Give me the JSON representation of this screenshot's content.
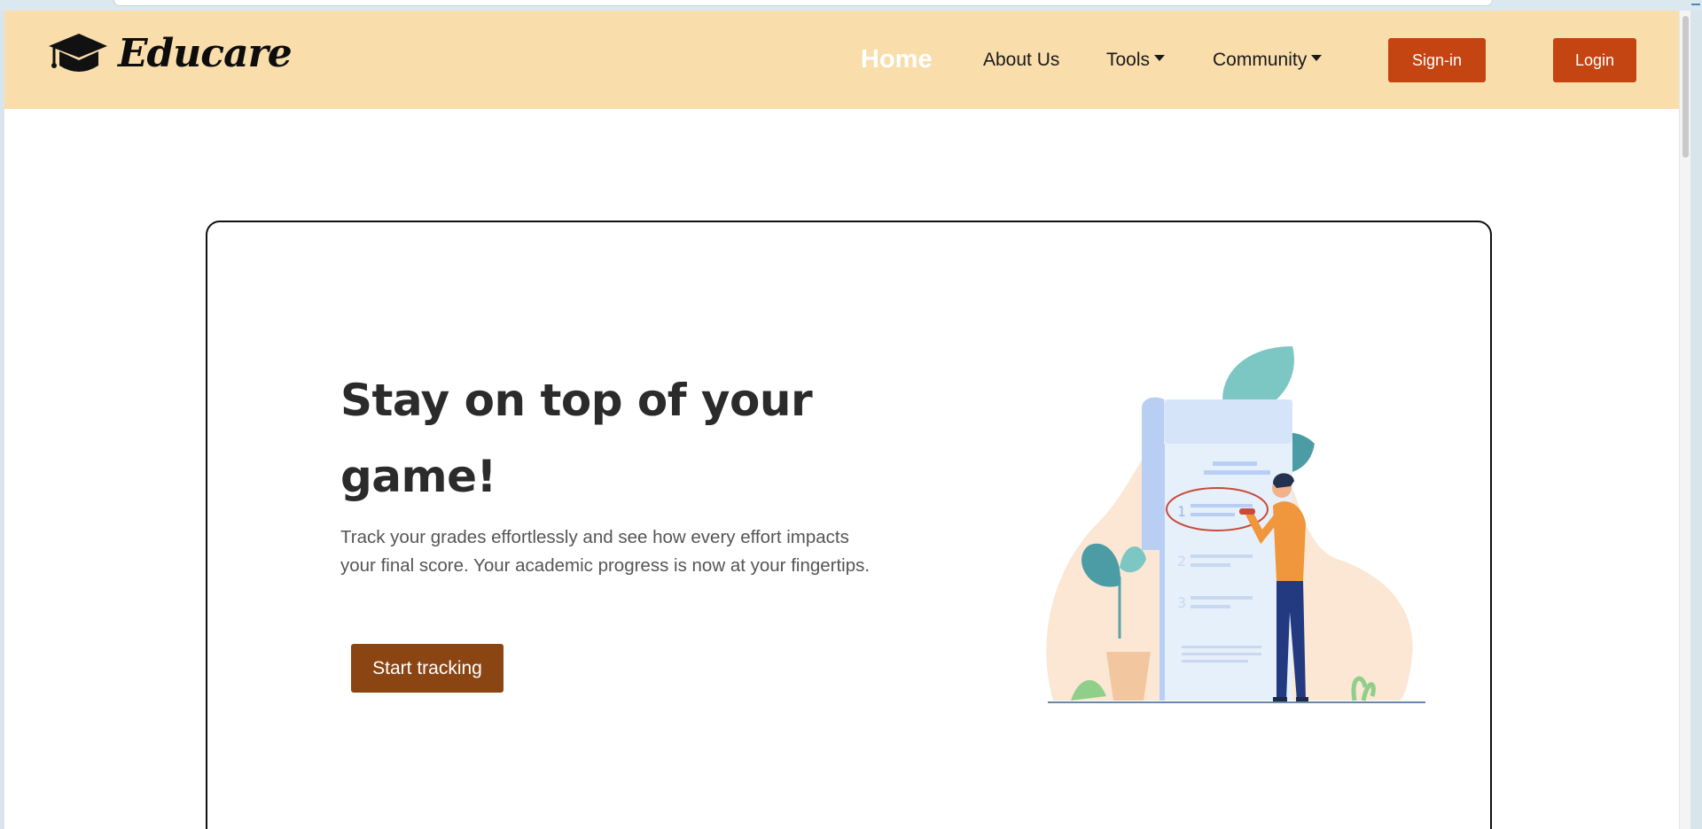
{
  "brand": {
    "name": "Educare",
    "icon": "graduation-cap-icon"
  },
  "nav": {
    "home": "Home",
    "about": "About Us",
    "tools": "Tools",
    "community": "Community",
    "signin": "Sign-in",
    "login": "Login"
  },
  "hero": {
    "title": "Stay on top of your game!",
    "description": "Track your grades effortlessly and see how every effort impacts your final score. Your academic progress is now at your fingertips.",
    "cta": "Start tracking"
  },
  "illustration": {
    "list_numbers": [
      "1",
      "2",
      "3"
    ]
  },
  "colors": {
    "header_bg": "#f9deac",
    "accent": "#c44512",
    "cta": "#8b4513",
    "title": "#2b2b2b"
  }
}
